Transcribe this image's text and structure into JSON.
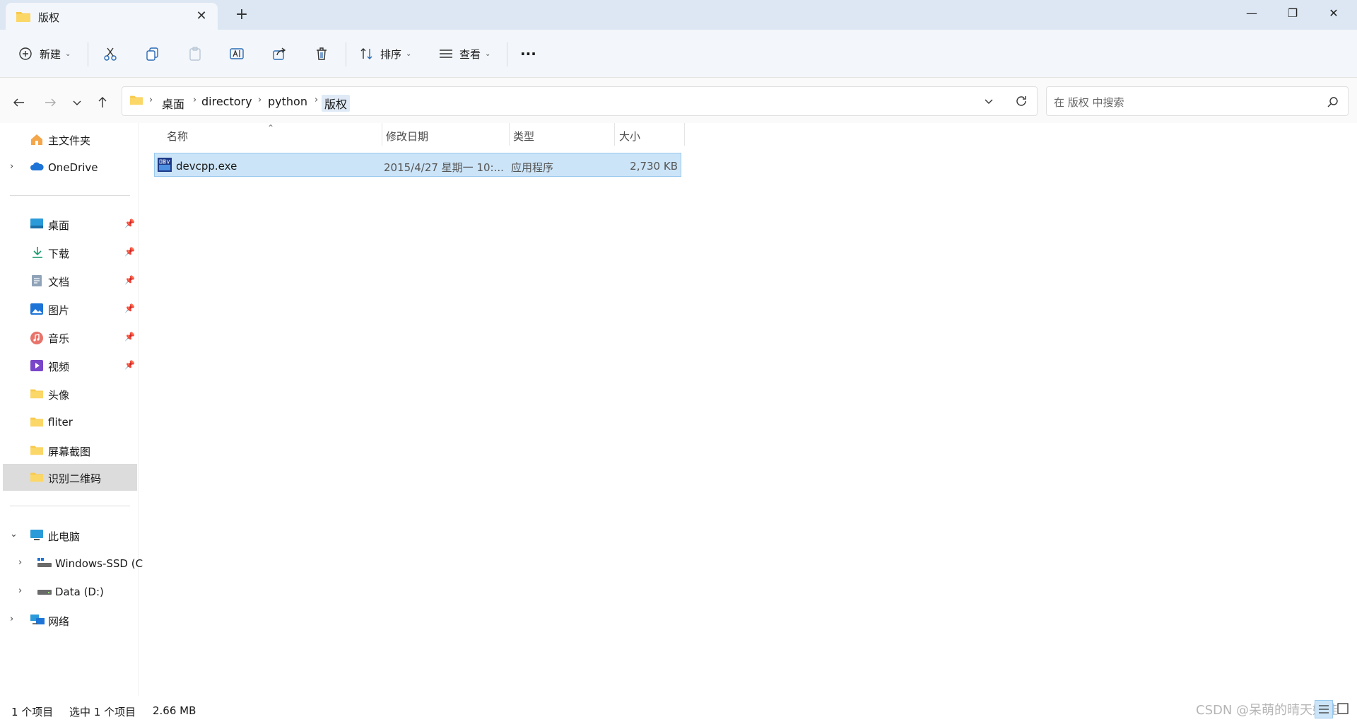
{
  "window": {
    "tab_title": "版权",
    "new_tab": "+",
    "minimize": "—",
    "maximize": "❐",
    "close": "✕",
    "tab_close": "✕"
  },
  "toolbar": {
    "new_label": "新建",
    "sort_label": "排序",
    "view_label": "查看",
    "more_label": "···"
  },
  "address": {
    "crumbs": [
      "桌面",
      "directory",
      "python",
      "版权"
    ],
    "search_placeholder": "在 版权 中搜索"
  },
  "sidebar": {
    "home": "主文件夹",
    "onedrive": "OneDrive",
    "quick": [
      {
        "label": "桌面"
      },
      {
        "label": "下载"
      },
      {
        "label": "文档"
      },
      {
        "label": "图片"
      },
      {
        "label": "音乐"
      },
      {
        "label": "视频"
      },
      {
        "label": "头像"
      },
      {
        "label": "fliter"
      },
      {
        "label": "屏幕截图"
      },
      {
        "label": "识别二维码"
      }
    ],
    "this_pc": "此电脑",
    "drive_c": "Windows-SSD (C",
    "drive_d": "Data (D:)",
    "network": "网络"
  },
  "filelist": {
    "columns": {
      "name": "名称",
      "date": "修改日期",
      "type": "类型",
      "size": "大小"
    },
    "rows": [
      {
        "name": "devcpp.exe",
        "date": "2015/4/27 星期一 10:...",
        "type": "应用程序",
        "size": "2,730 KB"
      }
    ]
  },
  "status": {
    "count": "1 个项目",
    "selected": "选中 1 个项目",
    "size": "2.66 MB"
  },
  "watermark": "CSDN @呆萌的晴天娃娃",
  "colors": {
    "accent": "#0067c0",
    "selected_row": "#cce4f7",
    "folder": "#f8c94a"
  }
}
